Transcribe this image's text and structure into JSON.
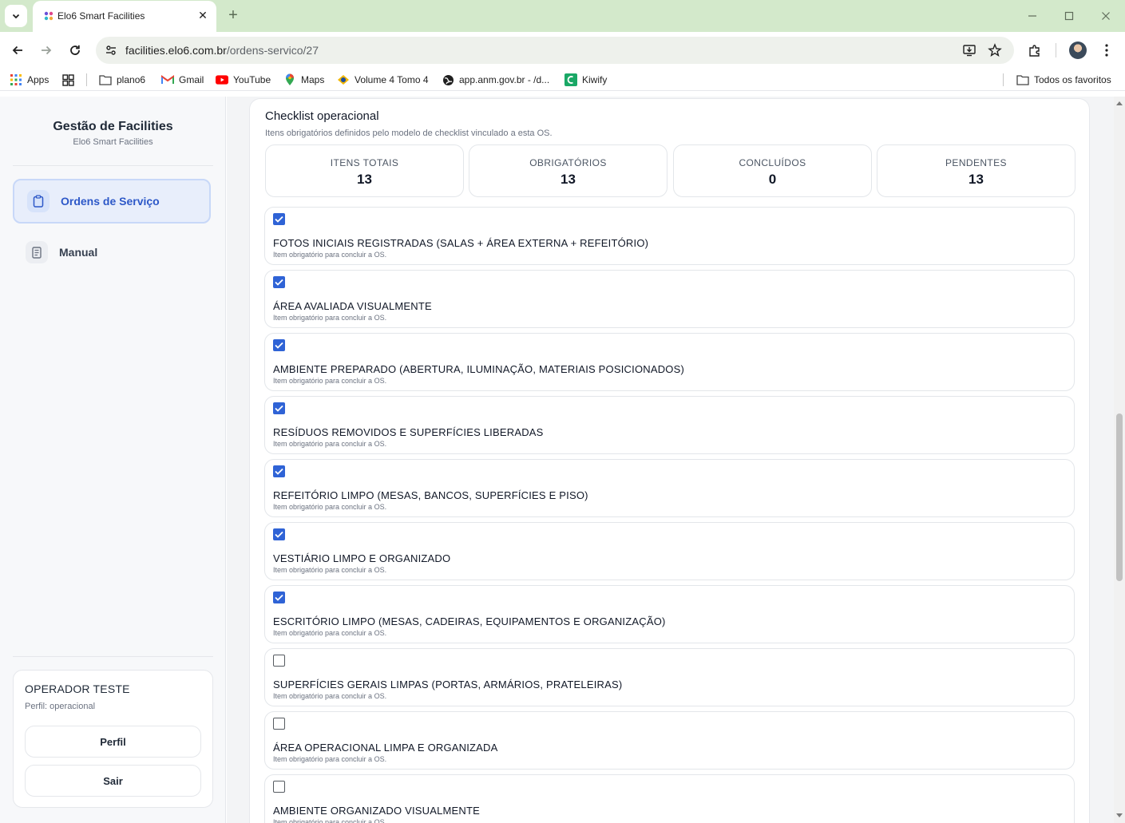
{
  "browser": {
    "tab_title": "Elo6 Smart Facilities",
    "url_host": "facilities.elo6.com.br",
    "url_path": "/ordens-servico/27",
    "bookmarks": [
      {
        "label": "Apps",
        "icon": "apps-grid-icon"
      },
      {
        "label": "",
        "icon": "tab-groups-icon"
      },
      {
        "label": "plano6",
        "icon": "folder-icon"
      },
      {
        "label": "Gmail",
        "icon": "gmail-icon"
      },
      {
        "label": "YouTube",
        "icon": "youtube-icon"
      },
      {
        "label": "Maps",
        "icon": "maps-pin-icon"
      },
      {
        "label": "Volume 4 Tomo 4",
        "icon": "site-icon"
      },
      {
        "label": "app.anm.gov.br - /d...",
        "icon": "globe-icon"
      },
      {
        "label": "Kiwify",
        "icon": "kiwify-icon"
      }
    ],
    "all_bookmarks_label": "Todos os favoritos"
  },
  "sidebar": {
    "title": "Gestão de Facilities",
    "subtitle": "Elo6 Smart Facilities",
    "nav": [
      {
        "label": "Ordens de Serviço",
        "icon": "clipboard-icon",
        "active": true
      },
      {
        "label": "Manual",
        "icon": "document-icon",
        "active": false
      }
    ],
    "user": {
      "name": "OPERADOR TESTE",
      "role": "Perfil: operacional",
      "profile_button": "Perfil",
      "logout_button": "Sair"
    }
  },
  "checklist": {
    "title": "Checklist operacional",
    "subtitle": "Itens obrigatórios definidos pelo modelo de checklist vinculado a esta OS.",
    "stats": [
      {
        "label": "ITENS TOTAIS",
        "value": "13"
      },
      {
        "label": "OBRIGATÓRIOS",
        "value": "13"
      },
      {
        "label": "CONCLUÍDOS",
        "value": "0"
      },
      {
        "label": "PENDENTES",
        "value": "13"
      }
    ],
    "items": [
      {
        "label": "FOTOS INICIAIS REGISTRADAS (SALAS + ÁREA EXTERNA + REFEITÓRIO)",
        "hint": "Item obrigatório para concluir a OS.",
        "checked": true
      },
      {
        "label": "ÁREA AVALIADA VISUALMENTE",
        "hint": "Item obrigatório para concluir a OS.",
        "checked": true
      },
      {
        "label": "AMBIENTE PREPARADO (ABERTURA, ILUMINAÇÃO, MATERIAIS POSICIONADOS)",
        "hint": "Item obrigatório para concluir a OS.",
        "checked": true
      },
      {
        "label": "RESÍDUOS REMOVIDOS E SUPERFÍCIES LIBERADAS",
        "hint": "Item obrigatório para concluir a OS.",
        "checked": true
      },
      {
        "label": "REFEITÓRIO LIMPO (MESAS, BANCOS, SUPERFÍCIES E PISO)",
        "hint": "Item obrigatório para concluir a OS.",
        "checked": true
      },
      {
        "label": "VESTIÁRIO LIMPO E ORGANIZADO",
        "hint": "Item obrigatório para concluir a OS.",
        "checked": true
      },
      {
        "label": "ESCRITÓRIO LIMPO (MESAS, CADEIRAS, EQUIPAMENTOS E ORGANIZAÇÃO)",
        "hint": "Item obrigatório para concluir a OS.",
        "checked": true
      },
      {
        "label": "SUPERFÍCIES GERAIS LIMPAS (PORTAS, ARMÁRIOS, PRATELEIRAS)",
        "hint": "Item obrigatório para concluir a OS.",
        "checked": false
      },
      {
        "label": "ÁREA OPERACIONAL LIMPA E ORGANIZADA",
        "hint": "Item obrigatório para concluir a OS.",
        "checked": false
      },
      {
        "label": "AMBIENTE ORGANIZADO VISUALMENTE",
        "hint": "Item obrigatório para concluir a OS.",
        "checked": false
      }
    ]
  },
  "colors": {
    "accent": "#2f63d6",
    "nav_active_text": "#2d58c8",
    "tabstrip": "#d3e9cb"
  }
}
